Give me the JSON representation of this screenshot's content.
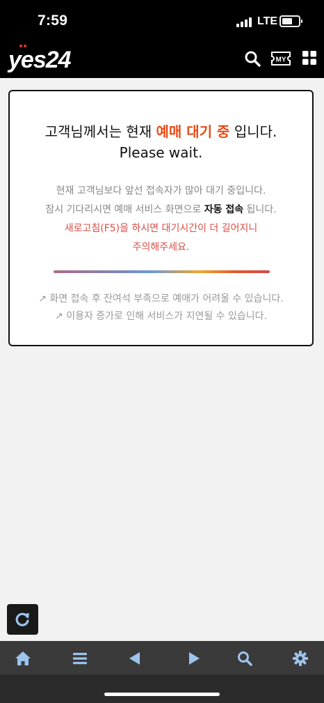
{
  "status_bar": {
    "time": "7:59",
    "network": "LTE"
  },
  "header": {
    "logo_text": "yes24",
    "icons": [
      "search-icon",
      "my-page-icon",
      "menu-grid-icon"
    ],
    "my_label": "MY"
  },
  "waiting": {
    "title_prefix": "고객님께서는 현재 ",
    "title_highlight": "예매 대기 중",
    "title_suffix": " 입니다.",
    "subtitle": "Please wait.",
    "line1": "현재 고객님보다 앞선 접속자가 많아 대기 중입니다.",
    "line2_prefix": "잠시 기다리시면 예매 서비스 화면으로 ",
    "line2_bold": "자동 접속",
    "line2_suffix": " 됩니다.",
    "warning1": "새로고침(F5)을 하시면 대기시간이 더 길어지니",
    "warning2": "주의해주세요.",
    "note1": "↗ 화면 접속 후 잔여석 부족으로 예매가 어려울 수 있습니다.",
    "note2": "↗ 이용자 증가로 인해 서비스가 지연될 수 있습니다."
  },
  "colors": {
    "highlight": "#e84a16",
    "warning": "#d94d45",
    "toolbar_icon": "#9cc3ec"
  },
  "floating_button": "refresh-icon",
  "bottom_toolbar": [
    "home-icon",
    "list-icon",
    "back-arrow-icon",
    "forward-arrow-icon",
    "search-icon",
    "settings-gear-icon"
  ]
}
